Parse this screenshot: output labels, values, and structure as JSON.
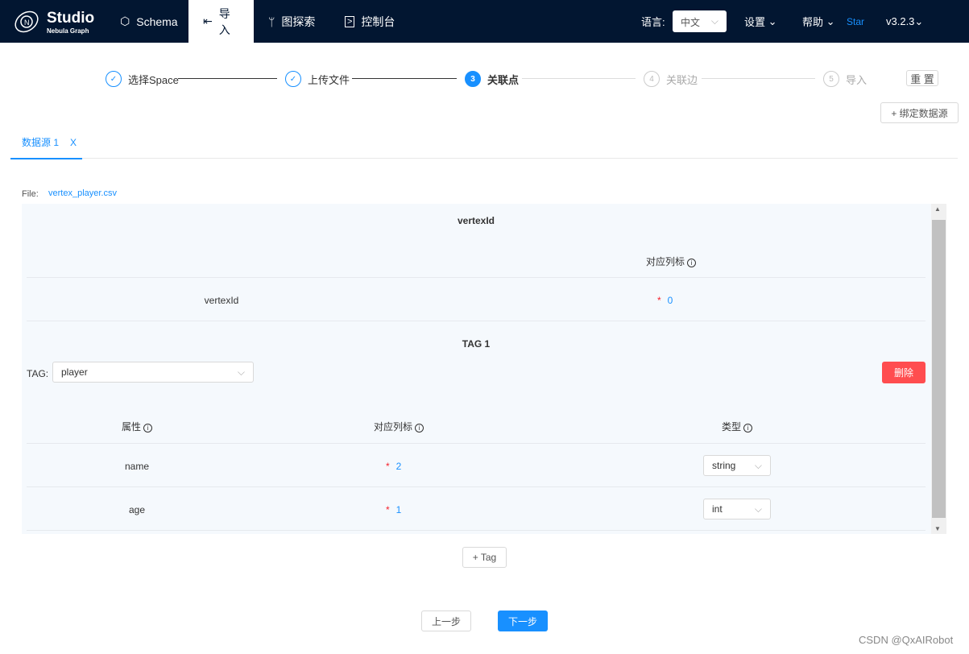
{
  "header": {
    "logo_title": "Studio",
    "logo_sub": "Nebula Graph",
    "nav": [
      {
        "label": "Schema",
        "icon": "hexagon-icon"
      },
      {
        "label": "导入",
        "icon": "import-icon"
      },
      {
        "label": "图探索",
        "icon": "branch-icon"
      },
      {
        "label": "控制台",
        "icon": "terminal-icon"
      }
    ],
    "lang_label": "语言:",
    "lang_value": "中文",
    "settings": "设置",
    "help": "帮助",
    "star": "Star",
    "version": "v3.2.3"
  },
  "steps": [
    {
      "label": "选择Space",
      "state": "done"
    },
    {
      "label": "上传文件",
      "state": "done"
    },
    {
      "num": "3",
      "label": "关联点",
      "state": "current"
    },
    {
      "num": "4",
      "label": "关联边",
      "state": "todo"
    },
    {
      "num": "5",
      "label": "导入",
      "state": "todo"
    }
  ],
  "reset": "重 置",
  "bind_source": "+ 绑定数据源",
  "tab": {
    "label": "数据源 1",
    "close": "X"
  },
  "file_label": "File:",
  "file_name": "vertex_player.csv",
  "vertex": {
    "title": "vertexId",
    "col_header": "对应列标",
    "row_name": "vertexId",
    "row_value": "0"
  },
  "tag": {
    "title": "TAG 1",
    "label": "TAG:",
    "value": "player",
    "delete": "删除",
    "headers": [
      "属性",
      "对应列标",
      "类型"
    ],
    "rows": [
      {
        "name": "name",
        "col": "2",
        "type": "string"
      },
      {
        "name": "age",
        "col": "1",
        "type": "int"
      }
    ]
  },
  "add_tag": "+ Tag",
  "prev": "上一步",
  "next": "下一步",
  "watermark": "CSDN @QxAIRobot",
  "colors": {
    "header": "#021631",
    "accent": "#1890ff",
    "danger": "#ff4d4f"
  }
}
